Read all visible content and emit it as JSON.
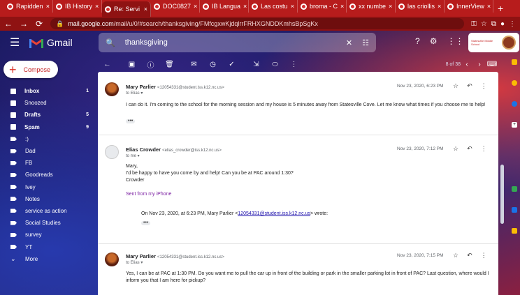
{
  "browser": {
    "tabs": [
      {
        "label": "Rapidden",
        "active": false
      },
      {
        "label": "IB History",
        "active": false
      },
      {
        "label": "Re: Servi",
        "active": true
      },
      {
        "label": "DOC0827",
        "active": false
      },
      {
        "label": "IB Langua",
        "active": false
      },
      {
        "label": "Las costu",
        "active": false
      },
      {
        "label": "broma - C",
        "active": false
      },
      {
        "label": "xx numbe",
        "active": false
      },
      {
        "label": "las criollis",
        "active": false
      },
      {
        "label": "InnerView",
        "active": false
      }
    ],
    "url_host": "mail.google.com",
    "url_path": "/mail/u/0/#search/thanksgiving/FMfcgxwKjdqlrrFRHXGNDDKmhsBpSgKx"
  },
  "gmail": {
    "logo_text": "Gmail",
    "search_value": "thanksgiving",
    "account_school": "Statesville Middle School"
  },
  "compose": {
    "label": "Compose"
  },
  "sidebar": {
    "items": [
      {
        "label": "Inbox",
        "count": "1",
        "icon": "inbox-icon",
        "bold": true
      },
      {
        "label": "Snoozed",
        "count": "",
        "icon": "clock-icon",
        "bold": false
      },
      {
        "label": "Drafts",
        "count": "5",
        "icon": "draft-icon",
        "bold": true
      },
      {
        "label": "Spam",
        "count": "9",
        "icon": "spam-icon",
        "bold": true
      },
      {
        "label": ":)",
        "count": "",
        "icon": "label-icon",
        "bold": false
      },
      {
        "label": "Dad",
        "count": "",
        "icon": "label-icon",
        "bold": false
      },
      {
        "label": "FB",
        "count": "",
        "icon": "label-icon",
        "bold": false
      },
      {
        "label": "Goodreads",
        "count": "",
        "icon": "label-icon",
        "bold": false
      },
      {
        "label": "Ivey",
        "count": "",
        "icon": "label-icon",
        "bold": false
      },
      {
        "label": "Notes",
        "count": "",
        "icon": "label-icon",
        "bold": false
      },
      {
        "label": "service as action",
        "count": "",
        "icon": "label-icon",
        "bold": false
      },
      {
        "label": "Social Studies",
        "count": "",
        "icon": "label-icon",
        "bold": false
      },
      {
        "label": "survey",
        "count": "",
        "icon": "label-icon",
        "bold": false
      },
      {
        "label": "YT",
        "count": "",
        "icon": "label-icon",
        "bold": false
      },
      {
        "label": "More",
        "count": "",
        "icon": "chevron-down-icon",
        "bold": false
      }
    ]
  },
  "toolbar": {
    "pagination": "8 of 38"
  },
  "messages": [
    {
      "sender": "Mary Parlier",
      "email": "<12054331@student.iss.k12.nc.us>",
      "to": "to Elias",
      "date": "Nov 23, 2020, 6:23 PM",
      "body": "I can do it. I'm coming to the school for the morning session and my house is 5 minutes away from Statesville Cove. Let me know what times if you choose me to help!"
    },
    {
      "sender": "Elias Crowder",
      "email": "<elias_crowder@iss.k12.nc.us>",
      "to": "to me",
      "date": "Nov 23, 2020, 7:12 PM",
      "line1": "Mary,",
      "line2": "I'd be happy to have you come by and help! Can you be at PAC around 1:30?",
      "line3": "Crowder",
      "signature": "Sent from my iPhone",
      "quote_prefix": "On Nov 23, 2020, at 6:23 PM, Mary Parlier <",
      "quote_link": "12054331@student.iss.k12.nc.us",
      "quote_suffix": "> wrote:"
    },
    {
      "sender": "Mary Parlier",
      "email": "<12054331@student.iss.k12.nc.us>",
      "to": "to Elias",
      "date": "Nov 23, 2020, 7:15 PM",
      "body": "Yes, I can be at PAC at 1:30 PM. Do you want me to pull the car up in front of the building or park in the smaller parking lot in front of PAC? Last question, where would I inform you that I am here for pickup?"
    }
  ]
}
